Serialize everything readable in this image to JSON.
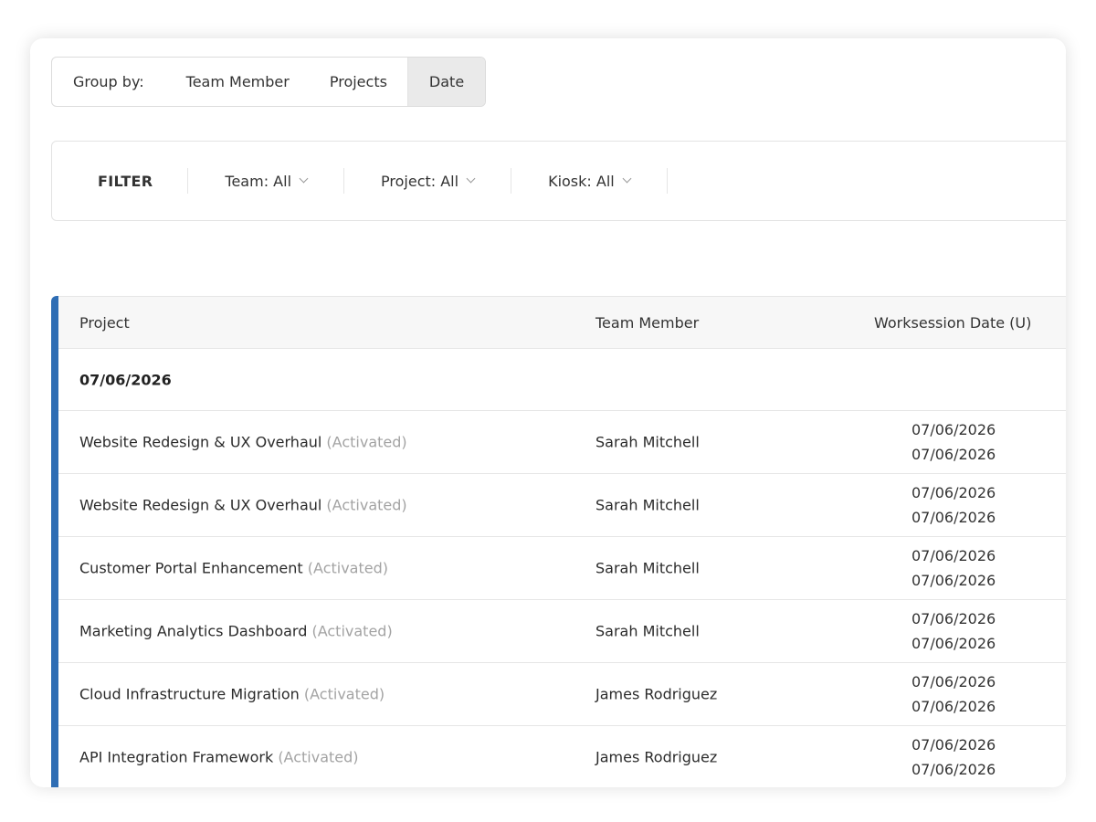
{
  "groupby": {
    "label": "Group by:",
    "options": [
      "Team Member",
      "Projects",
      "Date"
    ],
    "active": "Date"
  },
  "filter": {
    "title": "FILTER",
    "team": "Team: All",
    "project": "Project: All",
    "kiosk": "Kiosk: All"
  },
  "table": {
    "headers": {
      "project": "Project",
      "member": "Team Member",
      "date": "Worksession Date (U)"
    },
    "group_label": "07/06/2026",
    "rows": [
      {
        "project": "Website Redesign & UX Overhaul",
        "status": "(Activated)",
        "member": "Sarah Mitchell",
        "date1": "07/06/2026",
        "date2": "07/06/2026"
      },
      {
        "project": "Website Redesign & UX Overhaul",
        "status": "(Activated)",
        "member": "Sarah Mitchell",
        "date1": "07/06/2026",
        "date2": "07/06/2026"
      },
      {
        "project": "Customer Portal Enhancement",
        "status": "(Activated)",
        "member": "Sarah Mitchell",
        "date1": "07/06/2026",
        "date2": "07/06/2026"
      },
      {
        "project": "Marketing Analytics Dashboard",
        "status": "(Activated)",
        "member": "Sarah Mitchell",
        "date1": "07/06/2026",
        "date2": "07/06/2026"
      },
      {
        "project": "Cloud Infrastructure Migration",
        "status": "(Activated)",
        "member": "James Rodriguez",
        "date1": "07/06/2026",
        "date2": "07/06/2026"
      },
      {
        "project": "API Integration Framework",
        "status": "(Activated)",
        "member": "James Rodriguez",
        "date1": "07/06/2026",
        "date2": "07/06/2026"
      }
    ]
  },
  "colors": {
    "accent": "#2e6db4",
    "active_option_bg": "#eaeaea",
    "status_text": "#a3a3a3"
  },
  "icons": {
    "dropdown": "chevron-down-icon"
  }
}
